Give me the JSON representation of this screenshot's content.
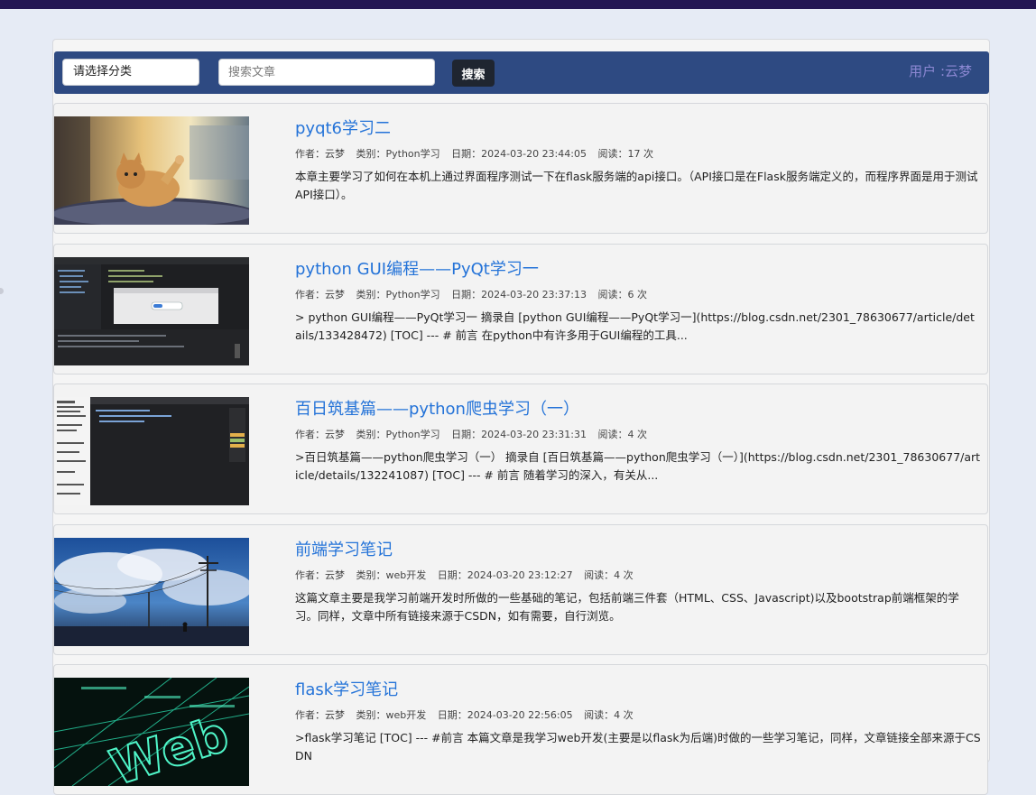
{
  "nav": {
    "category_select": "请选择分类",
    "search_placeholder": "搜索文章",
    "search_button": "搜索",
    "user_label": "用户 :云梦"
  },
  "articles": [
    {
      "title": "pyqt6学习二",
      "author": "作者：云梦",
      "category": "类别：Python学习",
      "date": "日期：2024-03-20 23:44:05",
      "views": "阅读：17 次",
      "summary": "本章主要学习了如何在本机上通过界面程序测试一下在flask服务端的api接口。（API接口是在Flask服务端定义的，而程序界面是用于测试API接口）。",
      "thumb": "cat-photo"
    },
    {
      "title": "python GUI编程——PyQt学习一",
      "author": "作者：云梦",
      "category": "类别：Python学习",
      "date": "日期：2024-03-20 23:37:13",
      "views": "阅读：6 次",
      "summary": "> python GUI编程——PyQt学习一 摘录自 [python GUI编程——PyQt学习一](https://blog.csdn.net/2301_78630677/article/details/133428472) [TOC] --- # 前言 在python中有许多用于GUI编程的工具...",
      "thumb": "ide-screenshot"
    },
    {
      "title": "百日筑基篇——python爬虫学习（一）",
      "author": "作者：云梦",
      "category": "类别：Python学习",
      "date": "日期：2024-03-20 23:31:31",
      "views": "阅读：4 次",
      "summary": ">百日筑基篇——python爬虫学习（一） 摘录自 [百日筑基篇——python爬虫学习（一）](https://blog.csdn.net/2301_78630677/article/details/132241087) [TOC] --- # 前言 随着学习的深入，有关从...",
      "thumb": "browser-devtools"
    },
    {
      "title": "前端学习笔记",
      "author": "作者：云梦",
      "category": "类别：web开发",
      "date": "日期：2024-03-20 23:12:27",
      "views": "阅读：4 次",
      "summary": "这篇文章主要是我学习前端开发时所做的一些基础的笔记，包括前端三件套（HTML、CSS、Javascript)以及bootstrap前端框架的学习。同样，文章中所有链接来源于CSDN，如有需要，自行浏览。",
      "thumb": "sky-clouds"
    },
    {
      "title": "flask学习笔记",
      "author": "作者：云梦",
      "category": "类别：web开发",
      "date": "日期：2024-03-20 22:56:05",
      "views": "阅读：4 次",
      "summary": ">flask学习笔记 [TOC] --- #前言 本篇文章是我学习web开发(主要是以flask为后端)时做的一些学习笔记，同样，文章链接全部来源于CSDN",
      "thumb": "web-neon"
    }
  ]
}
